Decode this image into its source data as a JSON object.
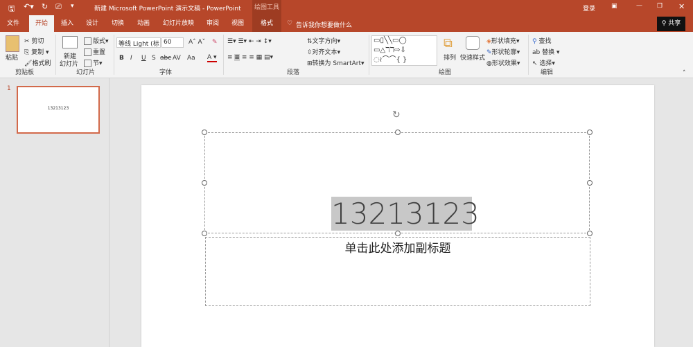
{
  "titlebar": {
    "title": "新建 Microsoft PowerPoint 演示文稿  -  PowerPoint",
    "context": "绘图工具",
    "login": "登录",
    "share": "共享"
  },
  "tabs": [
    "文件",
    "开始",
    "插入",
    "设计",
    "切换",
    "动画",
    "幻灯片放映",
    "审阅",
    "视图",
    "格式"
  ],
  "tellme": "告诉我你想要做什么",
  "ribbon": {
    "clipboard": {
      "paste": "粘贴",
      "cut": "剪切",
      "copy": "复制",
      "format_painter": "格式刷",
      "label": "剪贴板"
    },
    "slides": {
      "new": "新建",
      "new2": "幻灯片",
      "layout": "版式",
      "reset": "重置",
      "section": "节",
      "label": "幻灯片"
    },
    "font": {
      "name": "等线 Light (标",
      "size": "60",
      "label": "字体",
      "bold": "B",
      "italic": "I",
      "underline": "U",
      "shadow": "S",
      "strike": "abc",
      "spacing": "AV",
      "case": "Aa"
    },
    "paragraph": {
      "text_dir": "文字方向",
      "align_text": "对齐文本",
      "smartart": "转换为 SmartArt",
      "label": "段落"
    },
    "drawing": {
      "arrange": "排列",
      "quick_styles": "快速样式",
      "fill": "形状填充",
      "outline": "形状轮廓",
      "effects": "形状效果",
      "label": "绘图"
    },
    "editing": {
      "find": "查找",
      "replace": "替换",
      "select": "选择",
      "label": "编辑"
    }
  },
  "thumb": {
    "number": "1",
    "text": "13213123"
  },
  "slide": {
    "title": "13213123",
    "subtitle": "单击此处添加副标题"
  }
}
